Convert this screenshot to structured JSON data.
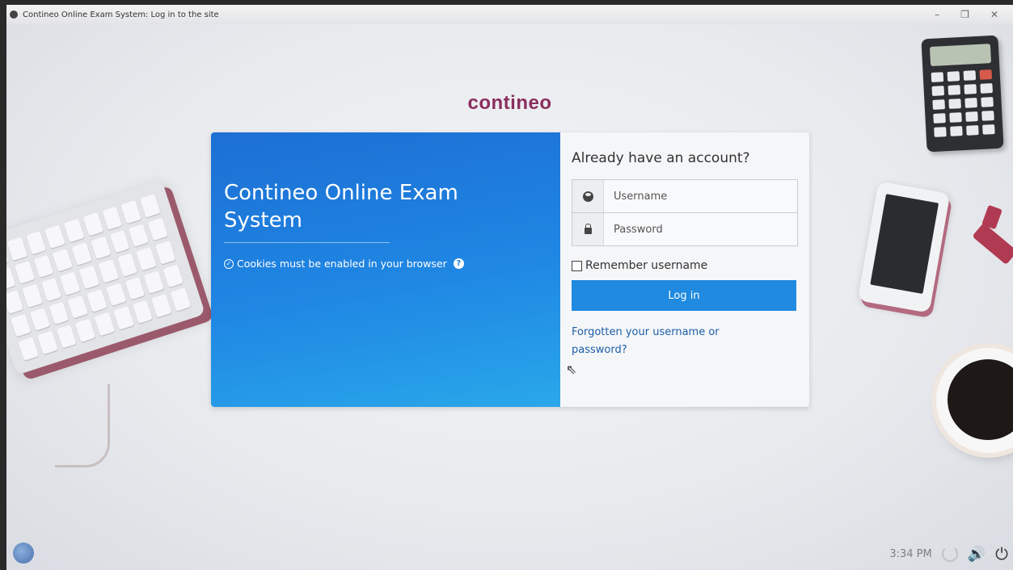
{
  "window": {
    "title": "Contineo Online Exam System: Log in to the site",
    "controls": [
      "–",
      "❐",
      "✕"
    ]
  },
  "logo": "contineo",
  "site": {
    "title": "Contineo Online Exam System",
    "cookies_notice": "Cookies must be enabled in your browser",
    "help_icon": "?"
  },
  "login": {
    "heading": "Already have an account?",
    "username_placeholder": "Username",
    "password_placeholder": "Password",
    "remember_label": "Remember username",
    "login_button": "Log in",
    "forgot_link": "Forgotten your username or password?"
  },
  "taskbar": {
    "clock": "3:34 PM",
    "volume_icon": "🔊",
    "power_icon": "⏻"
  },
  "colors": {
    "brand_blue": "#1f8ae0",
    "logo": "#8b2e5e",
    "link": "#1b5fa8"
  }
}
